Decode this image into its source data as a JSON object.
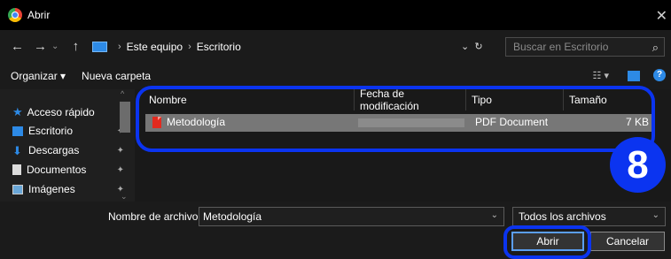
{
  "window": {
    "title": "Abrir",
    "close": "✕"
  },
  "nav": {
    "back": "←",
    "forward": "→",
    "recent": "⌄",
    "up": "↑",
    "breadcrumb": [
      "Este equipo",
      "Escritorio"
    ],
    "search_placeholder": "Buscar en Escritorio"
  },
  "toolbar": {
    "organize": "Organizar ▾",
    "new_folder": "Nueva carpeta",
    "help": "?"
  },
  "sidebar": {
    "items": [
      {
        "label": "Acceso rápido"
      },
      {
        "label": "Escritorio"
      },
      {
        "label": "Descargas"
      },
      {
        "label": "Documentos"
      },
      {
        "label": "Imágenes"
      }
    ]
  },
  "columns": {
    "name": "Nombre",
    "modified": "Fecha de modificación",
    "type": "Tipo",
    "size": "Tamaño"
  },
  "files": [
    {
      "name": "Metodología",
      "type": "PDF Document",
      "size": "7 KB"
    }
  ],
  "annotation": {
    "step": "8",
    "color": "#0b34f0"
  },
  "footer": {
    "filename_label": "Nombre de archivo:",
    "filename_value": "Metodología",
    "filetype": "Todos los archivos",
    "open": "Abrir",
    "cancel": "Cancelar"
  }
}
